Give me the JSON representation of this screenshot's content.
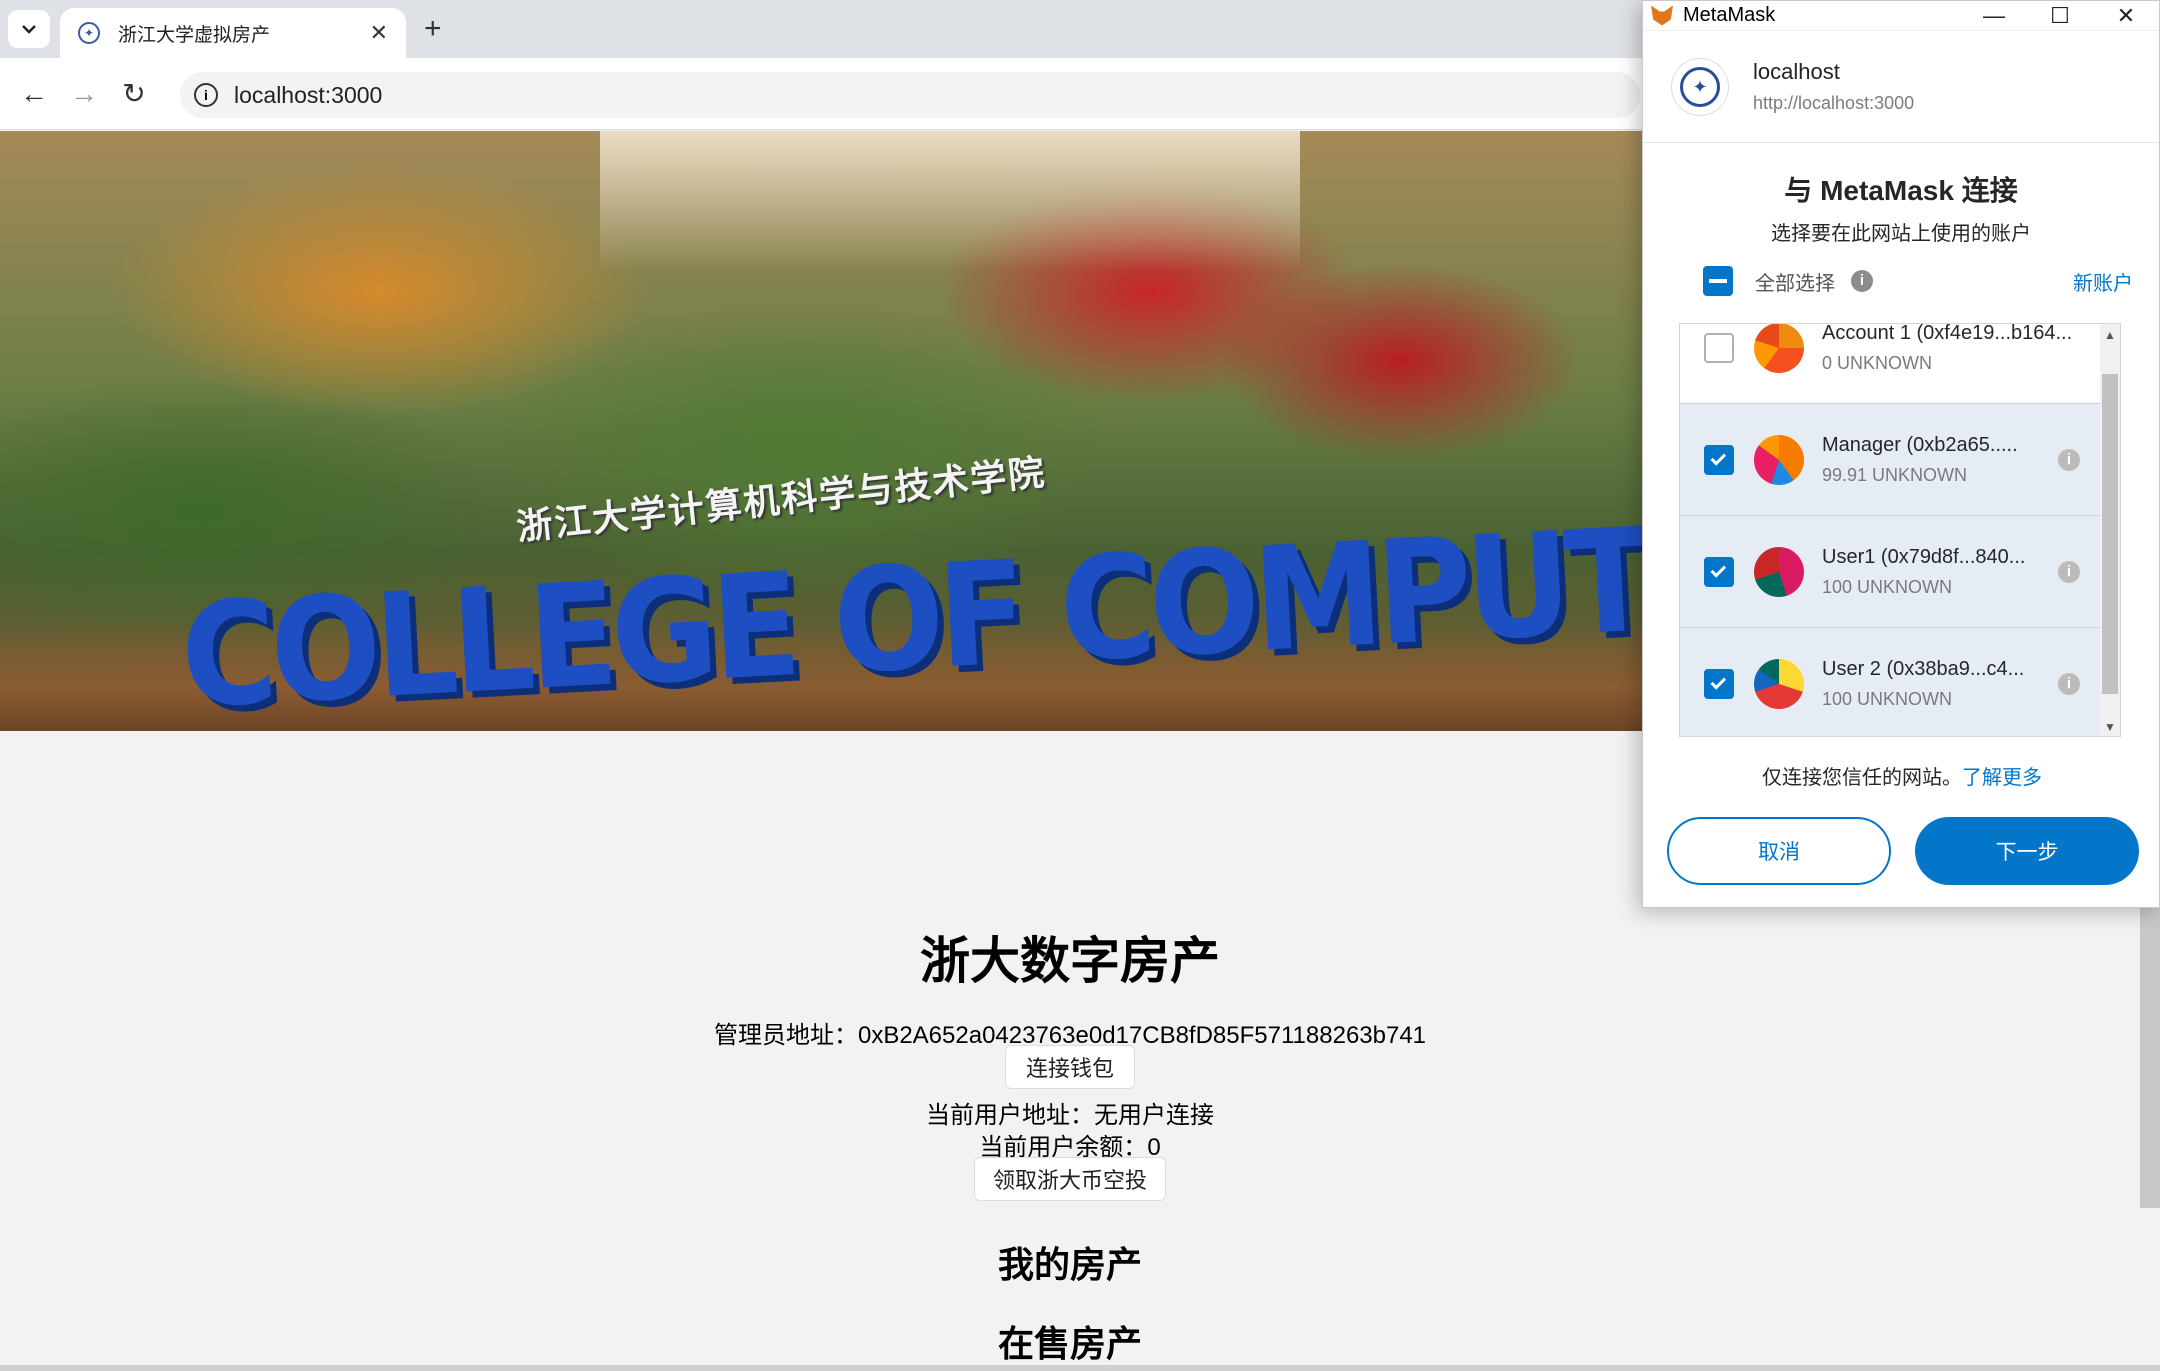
{
  "browser": {
    "tab_title": "浙江大学虚拟房产",
    "url": "localhost:3000"
  },
  "banner": {
    "sign_cn": "浙江大学计算机科学与技术学院",
    "sign_en": "COLLEGE OF COMPUTER SCIEN"
  },
  "page": {
    "title": "浙大数字房产",
    "admin_label": "管理员地址：",
    "admin_address": "0xB2A652a0423763e0d17CB8fD85F571188263b741",
    "connect_wallet": "连接钱包",
    "current_user_label": "当前用户地址：",
    "current_user_value": "无用户连接",
    "balance_label": "当前用户余额：",
    "balance_value": "0",
    "airdrop_button": "领取浙大币空投",
    "my_property": "我的房产",
    "on_sale": "在售房产"
  },
  "metamask": {
    "window_title": "MetaMask",
    "site_name": "localhost",
    "site_url": "http://localhost:3000",
    "heading": "与 MetaMask 连接",
    "subheading": "选择要在此网站上使用的账户",
    "select_all": "全部选择",
    "new_account": "新账户",
    "accounts": [
      {
        "name": "Account 1 (0xf4e19...b164...",
        "balance": "0 UNKNOWN",
        "checked": false
      },
      {
        "name": "Manager (0xb2a65.....",
        "balance": "99.91 UNKNOWN",
        "checked": true
      },
      {
        "name": "User1 (0x79d8f...840...",
        "balance": "100 UNKNOWN",
        "checked": true
      },
      {
        "name": "User 2 (0x38ba9...c4...",
        "balance": "100 UNKNOWN",
        "checked": true
      }
    ],
    "trust_text": "仅连接您信任的网站。",
    "learn_more": "了解更多",
    "cancel": "取消",
    "next": "下一步",
    "colors": {
      "accent": "#0376c9"
    }
  }
}
